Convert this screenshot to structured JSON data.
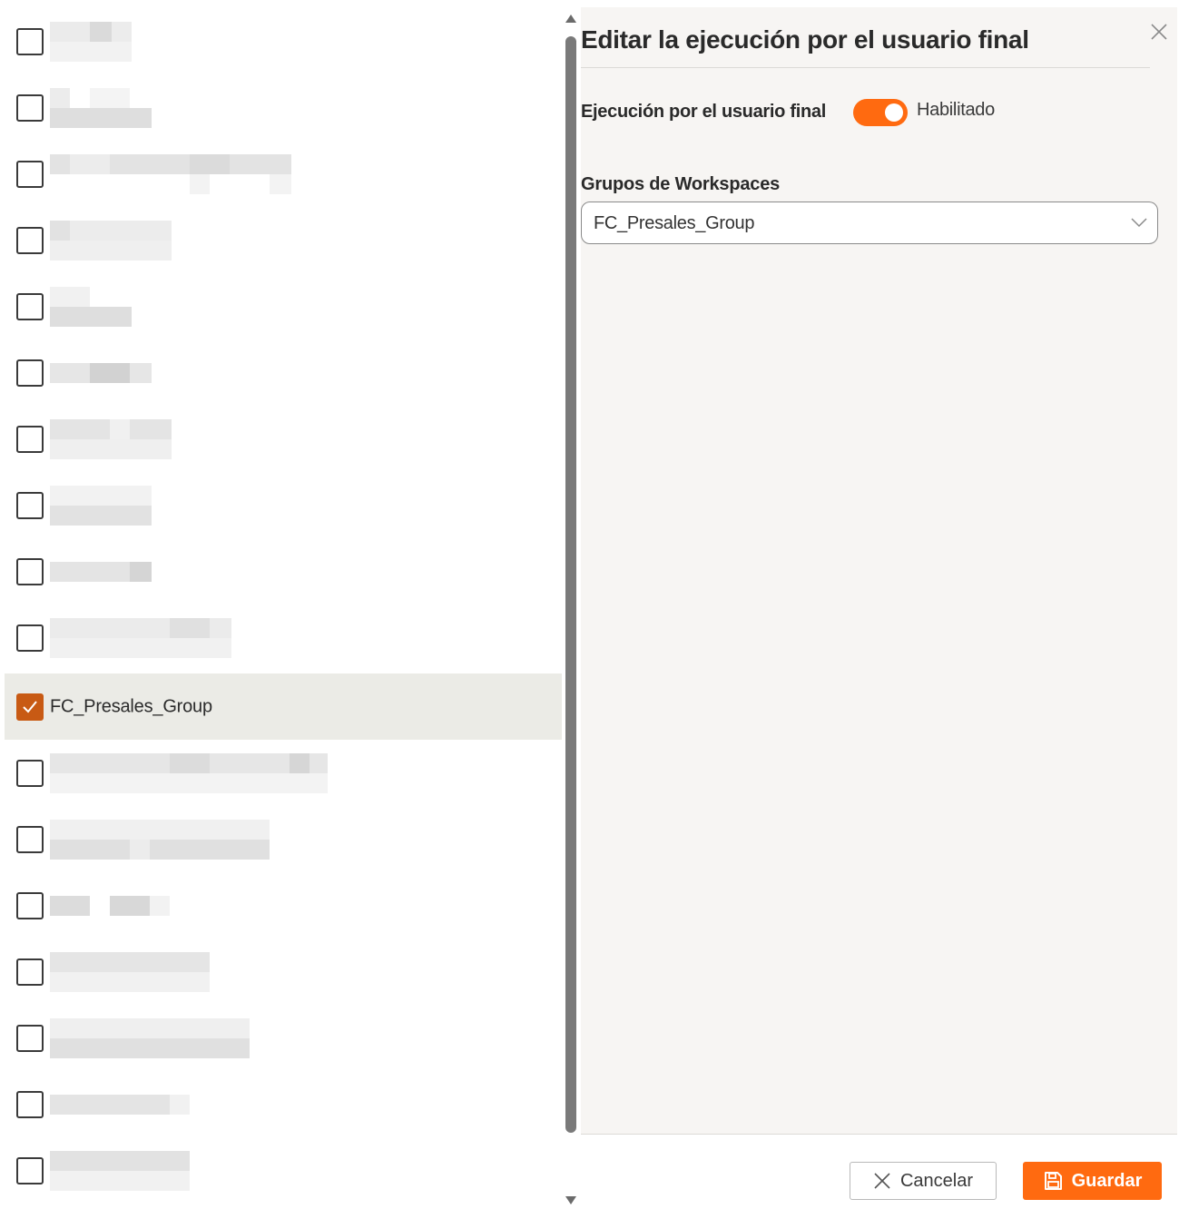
{
  "list": {
    "selected_item": {
      "label": "FC_Presales_Group",
      "checked": true
    }
  },
  "panel": {
    "title": "Editar la ejecución por el usuario final",
    "toggle_label": "Ejecución por el usuario final",
    "toggle_state": "Habilitado",
    "toggle_on": true,
    "select_label": "Grupos de Workspaces",
    "select_value": "FC_Presales_Group"
  },
  "footer": {
    "cancel_label": "Cancelar",
    "save_label": "Guardar"
  },
  "icons": {
    "close": "close-icon",
    "chevron": "chevron-down-icon",
    "cancel": "x-icon",
    "save": "floppy-disk-icon",
    "check": "checkmark-icon"
  },
  "colors": {
    "accent": "#ff6a10",
    "checkbox_checked": "#c85a14",
    "selected_row_bg": "#ebebe6",
    "panel_bg": "#f7f5f3"
  }
}
